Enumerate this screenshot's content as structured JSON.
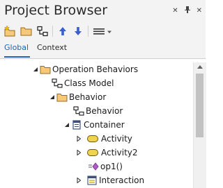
{
  "window": {
    "title": "Project Browser"
  },
  "window_controls": [
    {
      "name": "close-icon",
      "glyph": "✕"
    },
    {
      "name": "pin-icon",
      "glyph": "⊥"
    },
    {
      "name": "close-window-icon",
      "glyph": "✕"
    }
  ],
  "toolbar": [
    {
      "name": "new-package-icon"
    },
    {
      "name": "open-folder-icon"
    },
    {
      "name": "new-diagram-icon"
    },
    {
      "name": "move-up-icon"
    },
    {
      "name": "move-down-icon"
    },
    {
      "name": "menu-icon"
    }
  ],
  "tabs": [
    {
      "label": "Global",
      "active": true
    },
    {
      "label": "Context",
      "active": false
    }
  ],
  "tree": [
    {
      "label": "Operation Behaviors",
      "icon": "folder-icon",
      "twisty": "expanded",
      "level": 0
    },
    {
      "label": "Class Model",
      "icon": "diagram-icon",
      "twisty": "none",
      "level": 1
    },
    {
      "label": "Behavior",
      "icon": "folder-icon",
      "twisty": "expanded",
      "level": 1
    },
    {
      "label": "Behavior",
      "icon": "diagram-icon",
      "twisty": "none",
      "level": 2
    },
    {
      "label": "Container",
      "icon": "class-icon",
      "twisty": "expanded",
      "level": 2
    },
    {
      "label": "Activity",
      "icon": "activity-icon",
      "twisty": "collapsed",
      "level": 3
    },
    {
      "label": "Activity2",
      "icon": "activity-icon",
      "twisty": "collapsed",
      "level": 3
    },
    {
      "label": "op1()",
      "icon": "operation-icon",
      "twisty": "none",
      "level": 4
    },
    {
      "label": "Interaction",
      "icon": "interaction-icon",
      "twisty": "collapsed",
      "level": 3
    }
  ],
  "colors": {
    "accent": "#1f63b6",
    "folder": "#f6c879",
    "activity": "#f1d44d",
    "operation": "#b05cc8"
  }
}
